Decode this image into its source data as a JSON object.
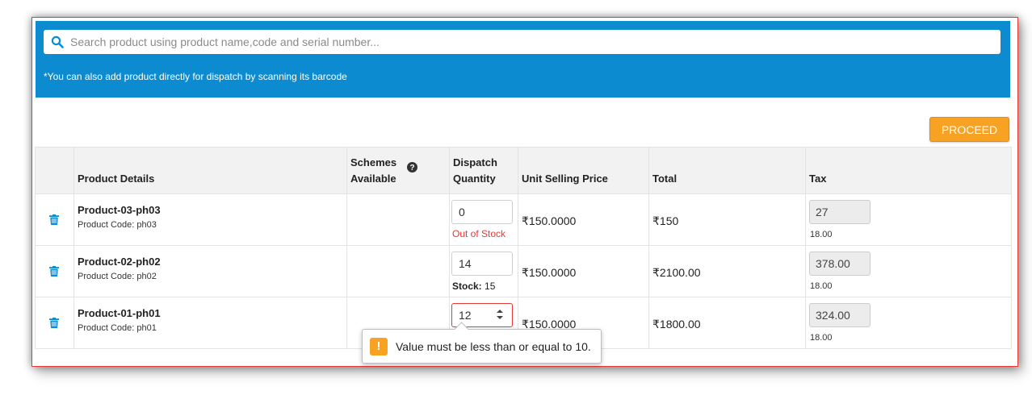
{
  "search": {
    "placeholder": "Search product using product name,code and serial number...",
    "note": "*You can also add product directly for dispatch by scanning its barcode"
  },
  "actions": {
    "proceed_label": "PROCEED"
  },
  "table": {
    "headers": {
      "product_details": "Product Details",
      "schemes_line1": "Schemes",
      "schemes_line2": "Available",
      "dispatch_line1": "Dispatch",
      "dispatch_line2": "Quantity",
      "unit_price": "Unit Selling Price",
      "total": "Total",
      "tax": "Tax"
    },
    "stock_label": "Stock:",
    "rows": [
      {
        "name": "Product-03-ph03",
        "code": "Product Code: ph03",
        "qty": "0",
        "status": "Out of Stock",
        "unit_price": "₹150.0000",
        "total": "₹150",
        "tax": "27",
        "tax_rate": "18.00"
      },
      {
        "name": "Product-02-ph02",
        "code": "Product Code: ph02",
        "qty": "14",
        "stock": "15",
        "unit_price": "₹150.0000",
        "total": "₹2100.00",
        "tax": "378.00",
        "tax_rate": "18.00"
      },
      {
        "name": "Product-01-ph01",
        "code": "Product Code: ph01",
        "qty": "12",
        "unit_price": "₹150.0000",
        "total": "₹1800.00",
        "tax": "324.00",
        "tax_rate": "18.00"
      }
    ]
  },
  "validation": {
    "message": "Value must be less than or equal to 10.",
    "icon": "exclamation-icon"
  },
  "colors": {
    "header_blue": "#0d8bd1",
    "accent_orange": "#f7a223",
    "error_red": "#e53935"
  }
}
